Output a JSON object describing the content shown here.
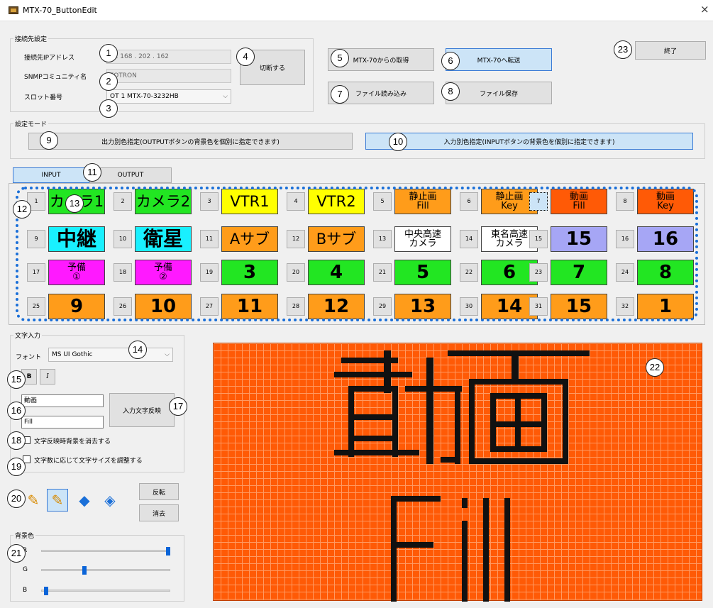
{
  "window": {
    "title": "MTX-70_ButtonEdit",
    "close_label": "×"
  },
  "connection": {
    "group_label": "接続先設定",
    "ip_label": "接続先IPアドレス",
    "ip_value": "2 . 168 . 202 . 162",
    "snmp_label": "SNMPコミュニティ名",
    "snmp_value": "FOTRON",
    "slot_label": "スロット番号",
    "slot_value": "OT 1  MTX-70-3232HB",
    "disconnect_label": "切断する"
  },
  "actions": {
    "fetch": "MTX-70からの取得",
    "transfer": "MTX-70へ転送",
    "load": "ファイル読み込み",
    "save": "ファイル保存",
    "exit": "終了"
  },
  "mode": {
    "group_label": "設定モード",
    "output_mode": "出力別色指定(OUTPUTボタンの背景色を個別に指定できます)",
    "input_mode": "入力別色指定(INPUTボタンの背景色を個別に指定できます)"
  },
  "tabs": {
    "input": "INPUT",
    "output": "OUTPUT"
  },
  "buttons": [
    {
      "n": "1",
      "text": "カメラ1",
      "bg": "#22e622",
      "style": "med"
    },
    {
      "n": "2",
      "text": "カメラ2",
      "bg": "#22e622",
      "style": "med"
    },
    {
      "n": "3",
      "text": "VTR1",
      "bg": "#ffff00",
      "style": "med"
    },
    {
      "n": "4",
      "text": "VTR2",
      "bg": "#ffff00",
      "style": "med"
    },
    {
      "n": "5",
      "text": "静止画",
      "text2": "Fill",
      "bg": "#ff9c1a",
      "style": "two"
    },
    {
      "n": "6",
      "text": "静止画",
      "text2": "Key",
      "bg": "#ff9c1a",
      "style": "two"
    },
    {
      "n": "7",
      "text": "動画",
      "text2": "Fill",
      "bg": "#ff5a06",
      "style": "two"
    },
    {
      "n": "8",
      "text": "動画",
      "text2": "Key",
      "bg": "#ff5a06",
      "style": "two"
    },
    {
      "n": "9",
      "text": "中継",
      "bg": "#19f0ff",
      "style": "big"
    },
    {
      "n": "10",
      "text": "衛星",
      "bg": "#19f0ff",
      "style": "big"
    },
    {
      "n": "11",
      "text": "Aサブ",
      "bg": "#ff9c1a",
      "style": "med"
    },
    {
      "n": "12",
      "text": "Bサブ",
      "bg": "#ff9c1a",
      "style": "med"
    },
    {
      "n": "13",
      "text": "中央高速",
      "text2": "カメラ",
      "bg": "#ffffff",
      "style": "two"
    },
    {
      "n": "14",
      "text": "東名高速",
      "text2": "カメラ",
      "bg": "#ffffff",
      "style": "two"
    },
    {
      "n": "15",
      "text": "15",
      "bg": "#a6a6f5",
      "style": "num"
    },
    {
      "n": "16",
      "text": "16",
      "bg": "#a6a6f5",
      "style": "num"
    },
    {
      "n": "17",
      "text": "予備",
      "text2": "①",
      "bg": "#ff19ff",
      "style": "two"
    },
    {
      "n": "18",
      "text": "予備",
      "text2": "②",
      "bg": "#ff19ff",
      "style": "two"
    },
    {
      "n": "19",
      "text": "3",
      "bg": "#22e622",
      "style": "num"
    },
    {
      "n": "20",
      "text": "4",
      "bg": "#22e622",
      "style": "num"
    },
    {
      "n": "21",
      "text": "5",
      "bg": "#22e622",
      "style": "num"
    },
    {
      "n": "22",
      "text": "6",
      "bg": "#22e622",
      "style": "num"
    },
    {
      "n": "23",
      "text": "7",
      "bg": "#22e622",
      "style": "num"
    },
    {
      "n": "24",
      "text": "8",
      "bg": "#22e622",
      "style": "num"
    },
    {
      "n": "25",
      "text": "9",
      "bg": "#ff9c1a",
      "style": "num"
    },
    {
      "n": "26",
      "text": "10",
      "bg": "#ff9c1a",
      "style": "num"
    },
    {
      "n": "27",
      "text": "11",
      "bg": "#ff9c1a",
      "style": "num"
    },
    {
      "n": "28",
      "text": "12",
      "bg": "#ff9c1a",
      "style": "num"
    },
    {
      "n": "29",
      "text": "13",
      "bg": "#ff9c1a",
      "style": "num"
    },
    {
      "n": "30",
      "text": "14",
      "bg": "#ff9c1a",
      "style": "num"
    },
    {
      "n": "31",
      "text": "15",
      "bg": "#ff9c1a",
      "style": "num"
    },
    {
      "n": "32",
      "text": "1",
      "bg": "#ff9c1a",
      "style": "num"
    }
  ],
  "text_input": {
    "group_label": "文字入力",
    "font_label": "フォント",
    "font_value": "MS UI Gothic",
    "bold_label": "B",
    "italic_label": "I",
    "line1": "動画",
    "line2": "Fill",
    "apply_label": "入力文字反映",
    "clear_bg_label": "文字反映時背景を消去する",
    "autosize_label": "文字数に応じて文字サイズを調整する"
  },
  "tools": {
    "invert_label": "反転",
    "erase_label": "消去"
  },
  "background": {
    "group_label": "背景色",
    "r_label": "R",
    "g_label": "G",
    "b_label": "B",
    "r_value": 1.0,
    "g_value": 0.33,
    "b_value": 0.02
  },
  "annotations": [
    "1",
    "2",
    "3",
    "4",
    "5",
    "6",
    "7",
    "8",
    "9",
    "10",
    "11",
    "12",
    "13",
    "14",
    "15",
    "16",
    "17",
    "18",
    "19",
    "20",
    "21",
    "22",
    "23"
  ]
}
